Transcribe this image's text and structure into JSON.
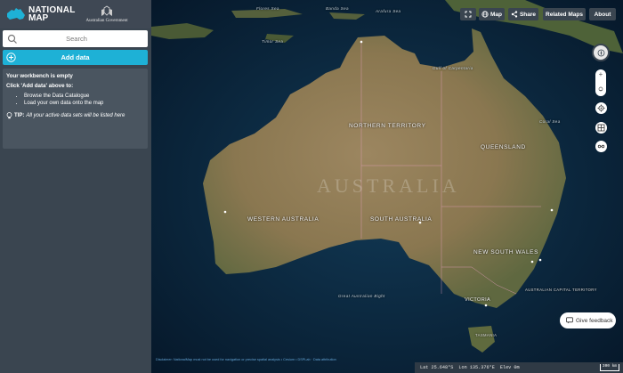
{
  "header": {
    "logo_line1": "NATIONAL",
    "logo_line2": "MAP",
    "gov_text": "Australian Government"
  },
  "search": {
    "placeholder": "Search"
  },
  "add_data": {
    "label": "Add data"
  },
  "workbench": {
    "title": "Your workbench is empty",
    "instruction": "Click 'Add data' above to:",
    "items": [
      "Browse the Data Catalogue",
      "Load your own data onto the map"
    ],
    "tip_label": "TIP:",
    "tip_text": "All your active data sets will be listed here"
  },
  "toolbar": {
    "map_label": "Map",
    "share_label": "Share",
    "related_label": "Related Maps",
    "about_label": "About"
  },
  "map_labels": {
    "northern_territory": "NORTHERN TERRITORY",
    "queensland": "QUEENSLAND",
    "western_australia": "WESTERN AUSTRALIA",
    "south_australia": "SOUTH AUSTRALIA",
    "new_south_wales": "NEW SOUTH WALES",
    "victoria": "VICTORIA",
    "act": "AUSTRALIAN CAPITAL TERRITORY",
    "tasmania": "TASMANIA",
    "australia": "AUSTRALIA",
    "timor_sea": "Timor Sea",
    "arafura_sea": "Arafura Sea",
    "gulf_carpentaria": "Gulf of Carpentaria",
    "coral_sea": "Coral Sea",
    "great_bight": "Great Australian Bight",
    "flores_sea": "Flores Sea",
    "banda_sea": "Banda Sea"
  },
  "feedback": {
    "label": "Give feedback"
  },
  "footer": {
    "disclaimer": "Disclaimer: NationalMap must not be used for navigation or precise spatial analysis • Cesium • DSPLab · Data attribution",
    "lat": "Lat  25.648°S",
    "lon": "Lon 135.376°E",
    "elev": "Elev 0m",
    "scale": "300 km"
  },
  "colors": {
    "sidebar": "#3a4550",
    "accent": "#1eb1d6",
    "ocean": "#0b2233",
    "land": "#8a7a55"
  }
}
